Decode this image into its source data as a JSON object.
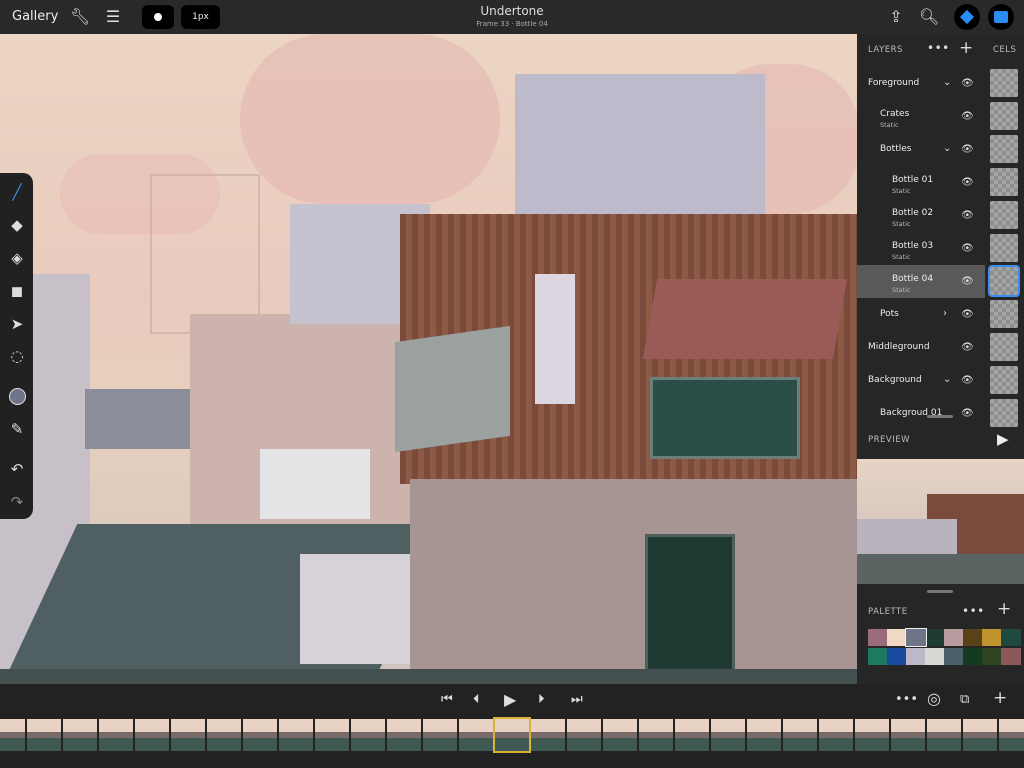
{
  "topbar": {
    "gallery": "Gallery",
    "brush_size": "1px",
    "title": "Undertone",
    "subtitle": "Frame 33 · Bottle 04",
    "icons": [
      "wrench-icon",
      "sliders-icon",
      "brush-shape-icon",
      "share-icon",
      "zoom-icon",
      "layers-diamond-icon",
      "panel-toggle-icon"
    ]
  },
  "tools": [
    "pencil-icon",
    "eraser-icon",
    "fill-bucket-icon",
    "shapes-icon",
    "move-arrow-icon",
    "lasso-select-icon",
    "color-swatch-icon",
    "eyedropper-icon",
    "undo-icon",
    "redo-icon"
  ],
  "layers_panel": {
    "header": "LAYERS",
    "cels_header": "CELS",
    "layers": [
      {
        "name": "Foreground",
        "sub": "",
        "indent": 0,
        "chevron": "down"
      },
      {
        "name": "Crates",
        "sub": "Static",
        "indent": 1,
        "chevron": ""
      },
      {
        "name": "Bottles",
        "sub": "",
        "indent": 1,
        "chevron": "down"
      },
      {
        "name": "Bottle 01",
        "sub": "Static",
        "indent": 2,
        "chevron": ""
      },
      {
        "name": "Bottle 02",
        "sub": "Static",
        "indent": 2,
        "chevron": ""
      },
      {
        "name": "Bottle 03",
        "sub": "Static",
        "indent": 2,
        "chevron": ""
      },
      {
        "name": "Bottle 04",
        "sub": "Static",
        "indent": 2,
        "chevron": "",
        "selected": true
      },
      {
        "name": "Pots",
        "sub": "",
        "indent": 1,
        "chevron": "right"
      },
      {
        "name": "Middleground",
        "sub": "",
        "indent": 0,
        "chevron": ""
      },
      {
        "name": "Background",
        "sub": "",
        "indent": 0,
        "chevron": "down"
      },
      {
        "name": "Backgroud 01",
        "sub": "",
        "indent": 1,
        "chevron": ""
      }
    ]
  },
  "preview": {
    "header": "PREVIEW"
  },
  "palette": {
    "header": "PALETTE",
    "selected_index": 2,
    "colors": [
      "#9a6b7a",
      "#f0d8c4",
      "#6e7588",
      "#1e3c33",
      "#b89ca0",
      "#5a4218",
      "#c09530",
      "#1f4a42",
      "#1e7a5e",
      "#1a4aa0",
      "#bcb8c8",
      "#d8d8d4",
      "#4a6068",
      "#153a22",
      "#2e4420",
      "#8a5858"
    ]
  },
  "timeline": {
    "selected_frame_index": 14,
    "visible_frames": 29
  }
}
